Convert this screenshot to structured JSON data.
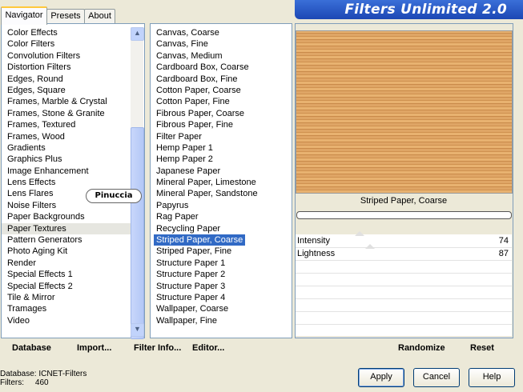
{
  "banner_title": "Filters Unlimited 2.0",
  "tabs": [
    {
      "label": "Navigator",
      "active": true
    },
    {
      "label": "Presets",
      "active": false
    },
    {
      "label": "About",
      "active": false
    }
  ],
  "categories": [
    "Color Effects",
    "Color Filters",
    "Convolution Filters",
    "Distortion Filters",
    "Edges, Round",
    "Edges, Square",
    "Frames, Marble & Crystal",
    "Frames, Stone & Granite",
    "Frames, Textured",
    "Frames, Wood",
    "Gradients",
    "Graphics Plus",
    "Image Enhancement",
    "Lens Effects",
    "Lens Flares",
    "Noise Filters",
    "Paper Backgrounds",
    "Paper Textures",
    "Pattern Generators",
    "Photo Aging Kit",
    "Render",
    "Special Effects 1",
    "Special Effects 2",
    "Tile & Mirror",
    "Tramages",
    "Video"
  ],
  "selected_category": "Paper Textures",
  "filters": [
    "Canvas, Coarse",
    "Canvas, Fine",
    "Canvas, Medium",
    "Cardboard Box, Coarse",
    "Cardboard Box, Fine",
    "Cotton Paper, Coarse",
    "Cotton Paper, Fine",
    "Fibrous Paper, Coarse",
    "Fibrous Paper, Fine",
    "Filter Paper",
    "Hemp Paper 1",
    "Hemp Paper 2",
    "Japanese Paper",
    "Mineral Paper, Limestone",
    "Mineral Paper, Sandstone",
    "Papyrus",
    "Rag Paper",
    "Recycling Paper",
    "Striped Paper, Coarse",
    "Striped Paper, Fine",
    "Structure Paper 1",
    "Structure Paper 2",
    "Structure Paper 3",
    "Structure Paper 4",
    "Wallpaper, Coarse",
    "Wallpaper, Fine"
  ],
  "selected_filter": "Striped Paper, Coarse",
  "preview_name": "Striped Paper, Coarse",
  "params": [
    {
      "label": "Intensity",
      "value": "74",
      "fraction": 0.29
    },
    {
      "label": "Lightness",
      "value": "87",
      "fraction": 0.34
    }
  ],
  "badge": "Pinuccia",
  "toolbar": {
    "database": "Database",
    "import": "Import...",
    "filter_info": "Filter Info...",
    "editor": "Editor...",
    "randomize": "Randomize",
    "reset": "Reset"
  },
  "status": {
    "database_label": "Database:",
    "database_value": "ICNET-Filters",
    "filters_label": "Filters:",
    "filters_value": "460"
  },
  "buttons": {
    "apply": "Apply",
    "cancel": "Cancel",
    "help": "Help"
  },
  "icons": {
    "scroll_up": "chevron-up-icon",
    "scroll_down": "chevron-down-icon"
  }
}
